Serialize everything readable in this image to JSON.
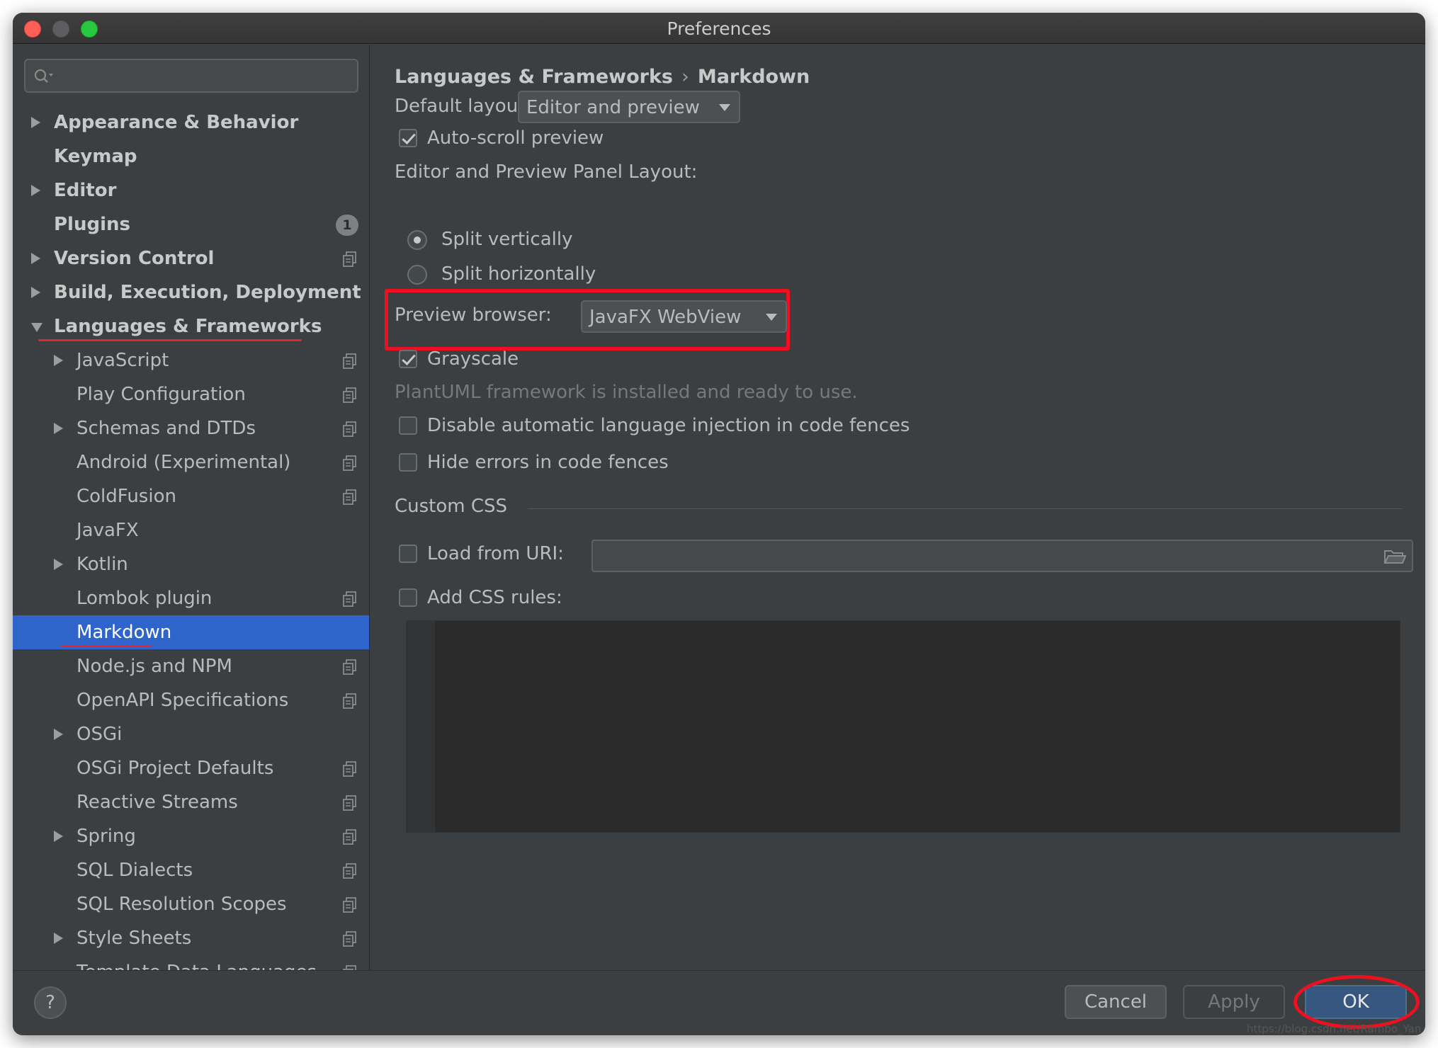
{
  "window": {
    "title": "Preferences"
  },
  "sidebar": {
    "search_placeholder": "",
    "items": [
      {
        "label": "Appearance & Behavior",
        "bold": true,
        "expander": "collapsed",
        "indent": 0,
        "project_icon": false
      },
      {
        "label": "Keymap",
        "bold": true,
        "expander": "none",
        "indent": 0,
        "project_icon": false
      },
      {
        "label": "Editor",
        "bold": true,
        "expander": "collapsed",
        "indent": 0,
        "project_icon": false
      },
      {
        "label": "Plugins",
        "bold": true,
        "expander": "none",
        "indent": 0,
        "project_icon": false,
        "badge": "1"
      },
      {
        "label": "Version Control",
        "bold": true,
        "expander": "collapsed",
        "indent": 0,
        "project_icon": true
      },
      {
        "label": "Build, Execution, Deployment",
        "bold": true,
        "expander": "collapsed",
        "indent": 0,
        "project_icon": false
      },
      {
        "label": "Languages & Frameworks",
        "bold": true,
        "expander": "expanded",
        "indent": 0,
        "project_icon": false,
        "underlined": true
      },
      {
        "label": "JavaScript",
        "bold": false,
        "expander": "collapsed",
        "indent": 1,
        "project_icon": true
      },
      {
        "label": "Play Configuration",
        "bold": false,
        "expander": "none",
        "indent": 1,
        "project_icon": true
      },
      {
        "label": "Schemas and DTDs",
        "bold": false,
        "expander": "collapsed",
        "indent": 1,
        "project_icon": true
      },
      {
        "label": "Android (Experimental)",
        "bold": false,
        "expander": "none",
        "indent": 1,
        "project_icon": true
      },
      {
        "label": "ColdFusion",
        "bold": false,
        "expander": "none",
        "indent": 1,
        "project_icon": true
      },
      {
        "label": "JavaFX",
        "bold": false,
        "expander": "none",
        "indent": 1,
        "project_icon": false
      },
      {
        "label": "Kotlin",
        "bold": false,
        "expander": "collapsed",
        "indent": 1,
        "project_icon": false
      },
      {
        "label": "Lombok plugin",
        "bold": false,
        "expander": "none",
        "indent": 1,
        "project_icon": true
      },
      {
        "label": "Markdown",
        "bold": false,
        "expander": "none",
        "indent": 1,
        "project_icon": false,
        "selected": true,
        "underlined": true
      },
      {
        "label": "Node.js and NPM",
        "bold": false,
        "expander": "none",
        "indent": 1,
        "project_icon": true
      },
      {
        "label": "OpenAPI Specifications",
        "bold": false,
        "expander": "none",
        "indent": 1,
        "project_icon": true
      },
      {
        "label": "OSGi",
        "bold": false,
        "expander": "collapsed",
        "indent": 1,
        "project_icon": false
      },
      {
        "label": "OSGi Project Defaults",
        "bold": false,
        "expander": "none",
        "indent": 1,
        "project_icon": true
      },
      {
        "label": "Reactive Streams",
        "bold": false,
        "expander": "none",
        "indent": 1,
        "project_icon": true
      },
      {
        "label": "Spring",
        "bold": false,
        "expander": "collapsed",
        "indent": 1,
        "project_icon": true
      },
      {
        "label": "SQL Dialects",
        "bold": false,
        "expander": "none",
        "indent": 1,
        "project_icon": true
      },
      {
        "label": "SQL Resolution Scopes",
        "bold": false,
        "expander": "none",
        "indent": 1,
        "project_icon": true
      },
      {
        "label": "Style Sheets",
        "bold": false,
        "expander": "collapsed",
        "indent": 1,
        "project_icon": true
      },
      {
        "label": "Template Data Languages",
        "bold": false,
        "expander": "none",
        "indent": 1,
        "project_icon": true
      }
    ]
  },
  "content": {
    "breadcrumb": {
      "parent": "Languages & Frameworks",
      "separator": "›",
      "current": "Markdown"
    },
    "default_layout": {
      "label": "Default layout:",
      "value": "Editor and preview"
    },
    "auto_scroll": {
      "label": "Auto-scroll preview",
      "checked": true
    },
    "panel_layout": {
      "label": "Editor and Preview Panel Layout:",
      "options": [
        {
          "label": "Split vertically",
          "selected": true
        },
        {
          "label": "Split horizontally",
          "selected": false
        }
      ]
    },
    "preview_browser": {
      "label": "Preview browser:",
      "value": "JavaFX WebView"
    },
    "grayscale": {
      "label": "Grayscale",
      "checked": true
    },
    "plantuml_status": "PlantUML framework is installed and ready to use.",
    "disable_injection": {
      "label": "Disable automatic language injection in code fences",
      "checked": false
    },
    "hide_errors": {
      "label": "Hide errors in code fences",
      "checked": false
    },
    "custom_css": {
      "section_title": "Custom CSS",
      "load_from_uri": {
        "label": "Load from URI:",
        "checked": false,
        "value": ""
      },
      "add_css_rules": {
        "label": "Add CSS rules:",
        "checked": false
      }
    }
  },
  "footer": {
    "help_label": "?",
    "cancel_label": "Cancel",
    "apply_label": "Apply",
    "ok_label": "OK"
  },
  "watermark": "https://blog.csdn.net/Rambo_Yan",
  "colors": {
    "background": "#3c3f41",
    "selection": "#2f65ca",
    "annotation_red": "#ee1020",
    "text": "#bbbbbb",
    "ok_button": "#365880"
  },
  "icons": {
    "search": "search-icon",
    "project_settings": "project-settings-icon",
    "folder": "folder-icon"
  }
}
